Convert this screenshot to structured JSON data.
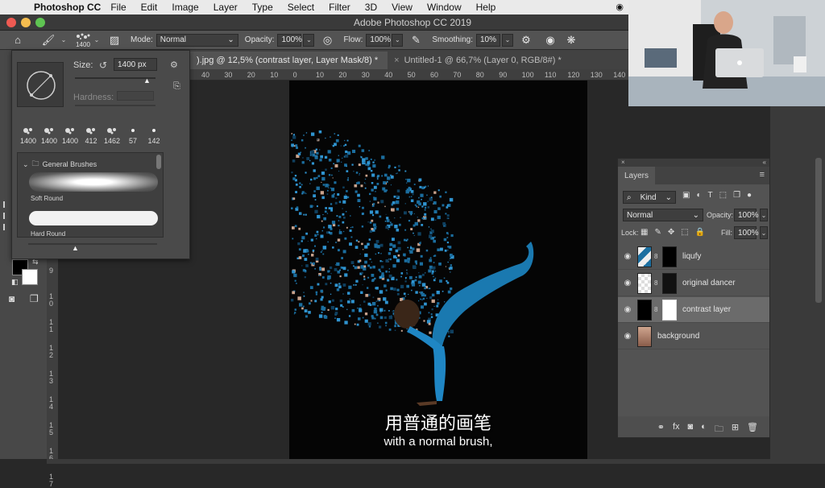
{
  "menubar": {
    "app_name": "Photoshop CC",
    "items": [
      "File",
      "Edit",
      "Image",
      "Layer",
      "Type",
      "Select",
      "Filter",
      "3D",
      "View",
      "Window",
      "Help"
    ]
  },
  "window": {
    "title": "Adobe Photoshop CC 2019"
  },
  "options_bar": {
    "brush_size": "1400",
    "mode_label": "Mode:",
    "mode_value": "Normal",
    "opacity_label": "Opacity:",
    "opacity_value": "100%",
    "flow_label": "Flow:",
    "flow_value": "100%",
    "smoothing_label": "Smoothing:",
    "smoothing_value": "10%"
  },
  "tabs": [
    {
      "label": ").jpg @ 12,5% (contrast layer, Layer Mask/8) *"
    },
    {
      "label": "Untitled-1 @ 66,7% (Layer 0, RGB/8#) *"
    }
  ],
  "ruler_top": [
    "40",
    "30",
    "20",
    "10",
    "0",
    "10",
    "20",
    "30",
    "40",
    "50",
    "60",
    "70",
    "80",
    "90",
    "100",
    "110",
    "120",
    "130",
    "140"
  ],
  "ruler_left": [
    "9",
    "1 0",
    "1 1",
    "1 2",
    "1 3",
    "1 4",
    "1 5",
    "1 6",
    "1 7"
  ],
  "brush_panel": {
    "size_label": "Size:",
    "size_value": "1400 px",
    "hardness_label": "Hardness:",
    "presets": [
      "1400",
      "1400",
      "1400",
      "412",
      "1462",
      "57",
      "142"
    ],
    "folder_label": "General Brushes",
    "brushes": [
      "Soft Round",
      "Hard Round"
    ]
  },
  "layers_panel": {
    "title": "Layers",
    "filter_kind": "Kind",
    "blend_mode": "Normal",
    "opacity_label": "Opacity:",
    "opacity_value": "100%",
    "lock_label": "Lock:",
    "fill_label": "Fill:",
    "fill_value": "100%",
    "layers": [
      {
        "name": "liqufy",
        "selected": false
      },
      {
        "name": "original dancer",
        "selected": false
      },
      {
        "name": "contrast layer",
        "selected": true
      },
      {
        "name": "background",
        "selected": false
      }
    ]
  },
  "subtitles": {
    "chinese": "用普通的画笔",
    "english": "with a normal brush,"
  },
  "colors": {
    "accent_blue": "#1e88c7",
    "panel_bg": "#535353",
    "canvas_bg": "#050505"
  }
}
